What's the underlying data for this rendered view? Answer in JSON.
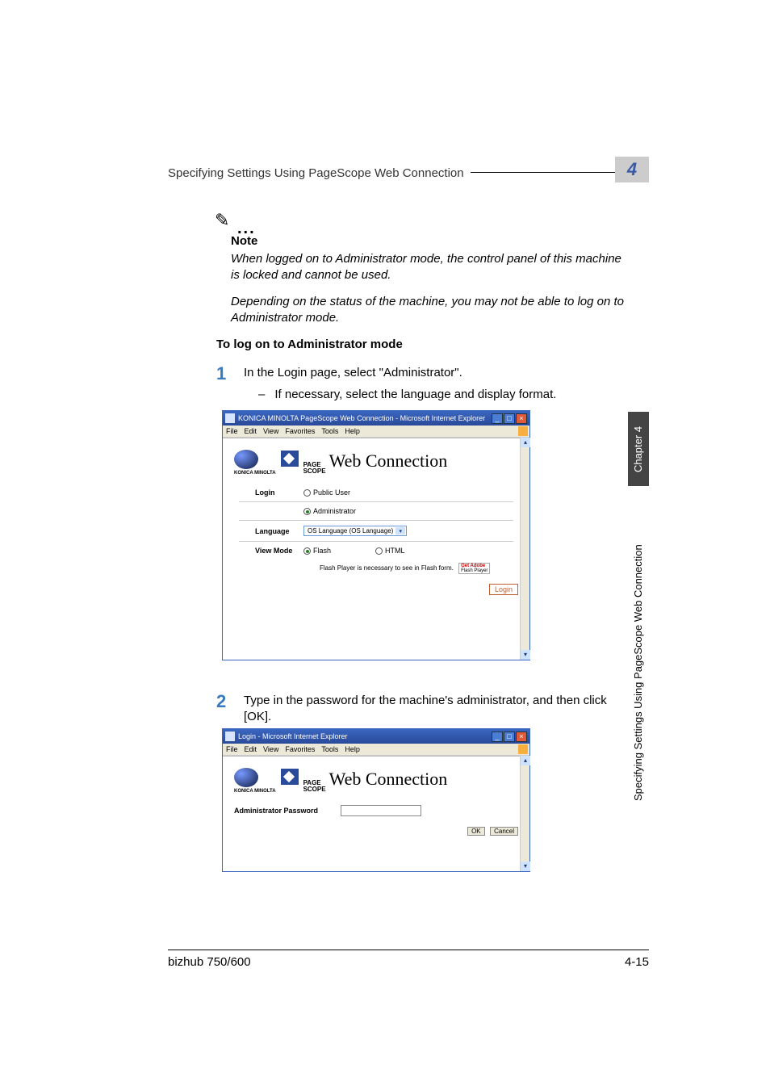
{
  "header": {
    "running_title": "Specifying Settings Using PageScope Web Connection",
    "chapter_number": "4"
  },
  "note": {
    "title": "Note",
    "p1": "When logged on to Administrator mode, the control panel of this machine is locked and cannot be used.",
    "p2": "Depending on the status of the machine, you may not be able to log on to Administrator mode."
  },
  "section_heading": "To log on to Administrator mode",
  "steps": {
    "s1": {
      "num": "1",
      "text": "In the Login page, select \"Administrator\".",
      "sub": "If necessary, select the language and display format."
    },
    "s2": {
      "num": "2",
      "text": "Type in the password for the machine's administrator, and then click [OK]."
    }
  },
  "browser1": {
    "title": "KONICA MINOLTA PageScope Web Connection - Microsoft Internet Explorer",
    "menus": [
      "File",
      "Edit",
      "View",
      "Favorites",
      "Tools",
      "Help"
    ],
    "km_brand": "KONICA MINOLTA",
    "ps_line1": "PAGE",
    "ps_line2": "SCOPE",
    "wc": "Web Connection",
    "login_label": "Login",
    "public_user": "Public User",
    "administrator": "Administrator",
    "language_label": "Language",
    "language_value": "OS Language (OS Language)",
    "view_mode_label": "View Mode",
    "flash": "Flash",
    "html": "HTML",
    "flash_note": "Flash Player is necessary to see in Flash form.",
    "adobe1": "Get Adobe",
    "adobe2": "Flash Player",
    "login_button": "Login"
  },
  "browser2": {
    "title": "Login - Microsoft Internet Explorer",
    "menus": [
      "File",
      "Edit",
      "View",
      "Favorites",
      "Tools",
      "Help"
    ],
    "km_brand": "KONICA MINOLTA",
    "ps_line1": "PAGE",
    "ps_line2": "SCOPE",
    "wc": "Web Connection",
    "admin_pw_label": "Administrator Password",
    "ok": "OK",
    "cancel": "Cancel"
  },
  "side": {
    "tab": "Chapter 4",
    "label": "Specifying Settings Using PageScope Web Connection"
  },
  "footer": {
    "left": "bizhub 750/600",
    "right": "4-15"
  }
}
